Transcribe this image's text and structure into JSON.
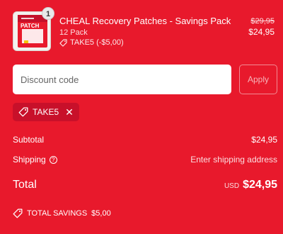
{
  "product": {
    "title": "CHEAL Recovery Patches - Savings Pack",
    "variant": "12 Pack",
    "discount": "TAKE5 (-$5,00)",
    "compare_price": "$29,95",
    "price": "$24,95",
    "quantity": "1",
    "thumb_text": "PATCH"
  },
  "discount_form": {
    "placeholder": "Discount code",
    "value": "",
    "apply_label": "Apply"
  },
  "applied_code": {
    "label": "TAKE5"
  },
  "summary": {
    "subtotal_label": "Subtotal",
    "subtotal_value": "$24,95",
    "shipping_label": "Shipping",
    "shipping_value": "Enter shipping address",
    "total_label": "Total",
    "currency": "USD",
    "total_value": "$24,95",
    "savings_label": "TOTAL SAVINGS",
    "savings_value": "$5,00"
  },
  "colors": {
    "background": "#e8192c",
    "chip": "#c8102a",
    "text": "#ffffff"
  },
  "icons": [
    "tag-icon",
    "close-icon",
    "help-icon"
  ]
}
